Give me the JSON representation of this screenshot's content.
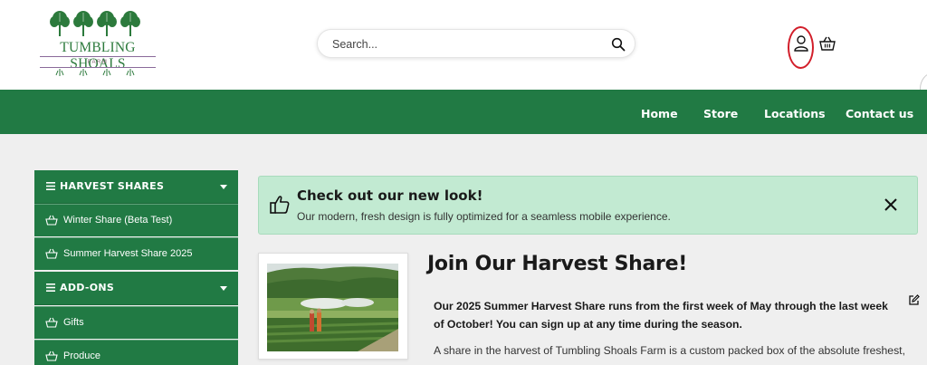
{
  "brand": {
    "name": "TUMBLING SHOALS",
    "sub": "FARM"
  },
  "search": {
    "placeholder": "Search..."
  },
  "icons": {
    "search": "search-icon",
    "account": "user-account-icon",
    "cart": "shopping-basket-icon",
    "close": "close-icon",
    "thumb": "thumbs-up-icon",
    "edit": "edit-icon"
  },
  "nav": {
    "items": [
      "Home",
      "Store",
      "Locations",
      "Contact us"
    ]
  },
  "sidebar": {
    "sections": [
      {
        "title": "HARVEST SHARES",
        "items": [
          "Winter Share (Beta Test)",
          "Summer Harvest Share 2025"
        ]
      },
      {
        "title": "ADD-ONS",
        "items": [
          "Gifts",
          "Produce"
        ]
      }
    ]
  },
  "alert": {
    "title": "Check out our new look!",
    "text": "Our modern, fresh design is fully optimized for a seamless mobile experience."
  },
  "content": {
    "heading": "Join Our Harvest Share!",
    "intro": "Our 2025 Summer Harvest Share runs from the first week of May through the last week of October! You can sign up at any time during the season.",
    "body": "A share in the harvest of Tumbling Shoals Farm is a custom packed box of the absolute freshest,"
  },
  "colors": {
    "brand_green": "#217a44",
    "alert_bg": "#c2ead2",
    "highlight_ring": "#d21e2a"
  }
}
